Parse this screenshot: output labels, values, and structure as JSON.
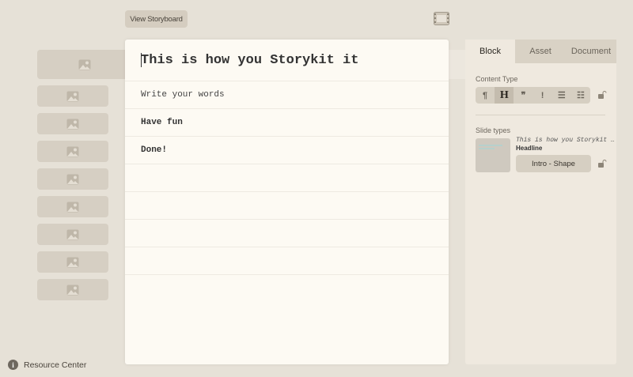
{
  "toolbar": {
    "view_storyboard": "View Storyboard"
  },
  "editor": {
    "rows": [
      "This is how you Storykit it",
      "Write your words",
      "Have fun",
      "Done!"
    ]
  },
  "panel": {
    "tabs": [
      "Block",
      "Asset",
      "Document"
    ],
    "content_type_label": "Content Type",
    "content_types": [
      "¶",
      "H",
      "❞",
      "!",
      "☰",
      "☷"
    ],
    "slide_types_label": "Slide types",
    "slide_text": "This is how you Storykit …",
    "slide_headline": "Headline",
    "slide_button": "Intro - Shape"
  },
  "footer": {
    "resource_center": "Resource Center",
    "info_icon": "i"
  }
}
